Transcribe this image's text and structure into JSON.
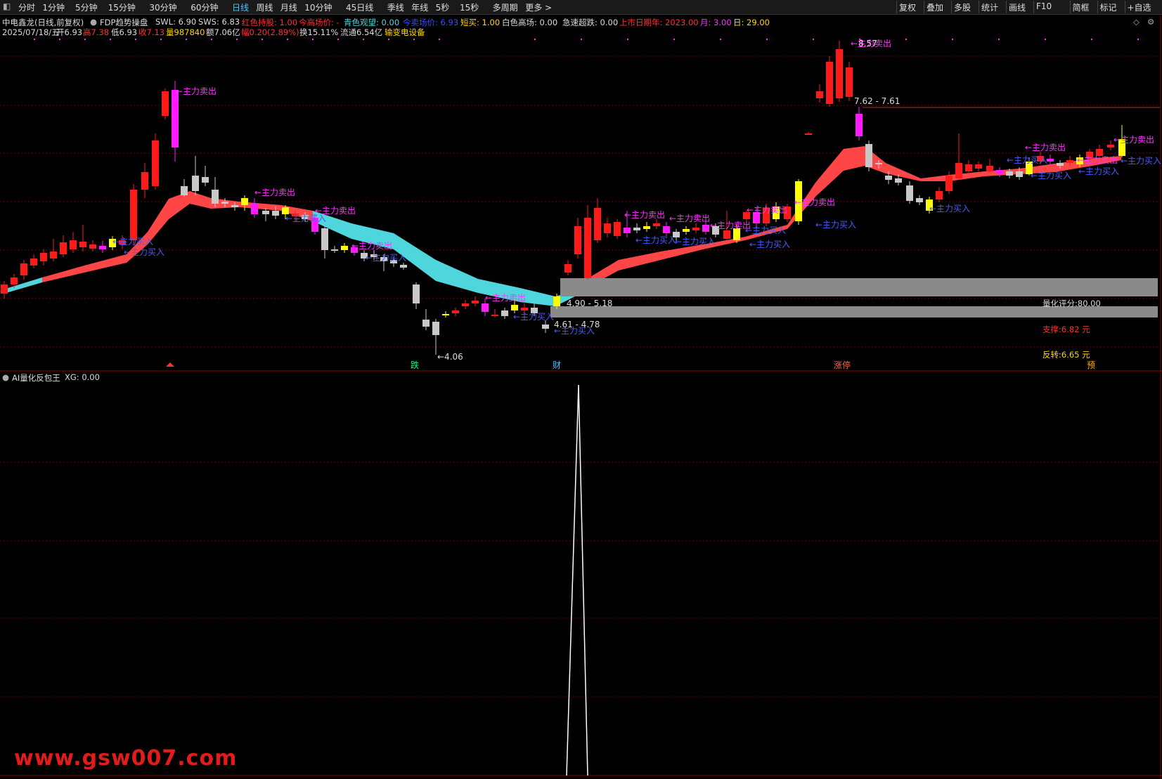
{
  "toolbar": {
    "left_items": [
      "分时",
      "1分钟",
      "5分钟",
      "15分钟",
      "30分钟",
      "60分钟",
      "日线",
      "周线",
      "月线",
      "10分钟",
      "45日线",
      "季线",
      "年线",
      "5秒",
      "15秒",
      "多周期",
      "更多 >"
    ],
    "active": "日线",
    "right_items": [
      "复权",
      "叠加",
      "多股",
      "统计",
      "画线",
      "F10",
      "简框",
      "标记",
      "+自选"
    ]
  },
  "header": {
    "title": "中电鑫龙(日线,前复权)",
    "indicator": "FDP趋势操盘",
    "swl": "SWL: 6.90",
    "sws": "SWS: 6.83",
    "red_hold": "红色持股: 1.00",
    "today_pos": "今高场价: -",
    "cyan_watch": "青色观望: 0.00",
    "sell_price": "今卖场价: 6.93",
    "short_buy": "短买: 1.00",
    "white_high": "白色高场: 0.00",
    "rapid_drop": "急速超跌: 0.00",
    "listing_year": "上市日期年: 2023.00",
    "month": "月: 3.00",
    "day": "日: 29.00"
  },
  "quote": {
    "date": "2025/07/18/五",
    "open": "开6.93",
    "high": "高7.38",
    "low": "低6.93",
    "close": "收7.13",
    "volume": "量987840",
    "amount": "额7.06亿",
    "change": "幅0.20(2.89%)",
    "turnover": "换15.11%",
    "float": "流通6.54亿",
    "sector": "输变电设备"
  },
  "chart_labels": {
    "main_sell": "←主力卖出",
    "main_buy": "←主力买入",
    "price_high": "8.57",
    "range_top": "7.62 - 7.61",
    "range_mid": "4.90 - 5.18",
    "range_low": "4.61 - 4.78",
    "price_low": "←4.06",
    "score": "量化评分:80.00",
    "support": "支撑:6.82 元",
    "reversal": "反转:6.65 元",
    "marker_die": "跌",
    "marker_cai": "财",
    "marker_zhangting": "涨停",
    "marker_yu": "预"
  },
  "sub_panel": {
    "title": "AI量化反包王",
    "xg": "XG: 0.00"
  },
  "watermark": "www.gsw007.com",
  "colors": {
    "up": "#ff2b2b",
    "down": "#00ff88",
    "ribbon_red": "#ff4646",
    "ribbon_cyan": "#4fd6dc",
    "buy_text": "#4a5cff",
    "sell_text": "#ff33ff",
    "grid": "#7a0000"
  }
}
